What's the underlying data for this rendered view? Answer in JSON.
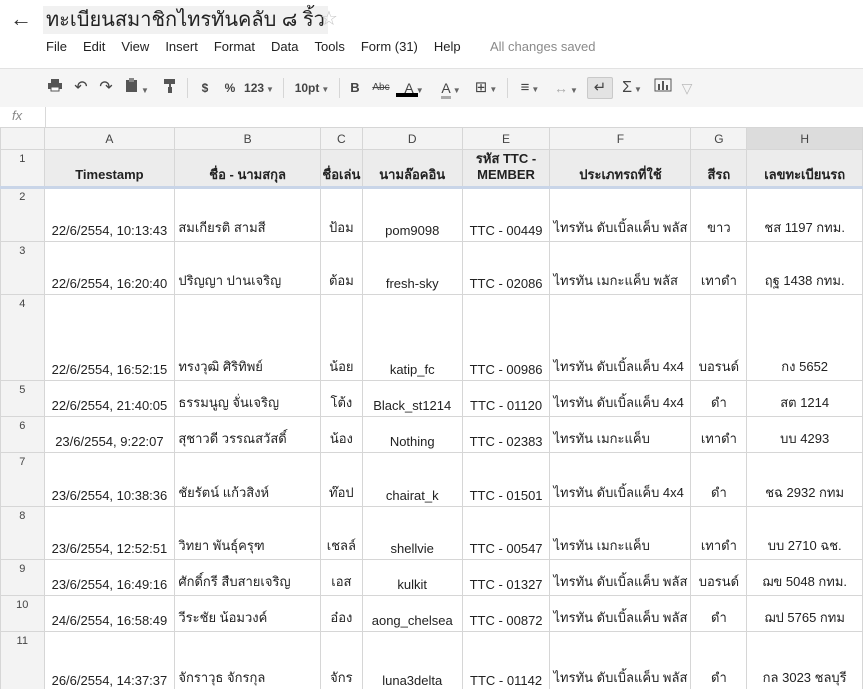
{
  "doc": {
    "title": "ทะเบียนสมาชิกไทรทันคลับ ๘ ริ้ว",
    "saved_status": "All changes saved"
  },
  "icons": {
    "back": "back-arrow-icon",
    "star": "star-icon"
  },
  "menu": [
    "File",
    "Edit",
    "View",
    "Insert",
    "Format",
    "Data",
    "Tools",
    "Form (31)",
    "Help"
  ],
  "toolbar": {
    "currency": "$",
    "percent": "%",
    "number_format": "123",
    "font_size": "10pt",
    "bold": "B",
    "strikethrough": "Abc",
    "text_color": "A",
    "highlight": "A",
    "sum": "Σ",
    "text_color_value": "#000000"
  },
  "formula_bar": {
    "label": "fx",
    "value": ""
  },
  "columns": [
    "A",
    "B",
    "C",
    "D",
    "E",
    "F",
    "G",
    "H"
  ],
  "selected_column": "H",
  "headers": [
    "Timestamp",
    "ชื่อ - นามสกุล",
    "ชื่อเล่น",
    "นามล๊อคอิน",
    "รหัส TTC - MEMBER",
    "ประเภทรถที่ใช้",
    "สีรถ",
    "เลขทะเบียนรถ"
  ],
  "rows": [
    {
      "num": "1"
    },
    {
      "num": "2",
      "cells": [
        "22/6/2554, 10:13:43",
        "สมเกียรติ สามสี",
        "ป้อม",
        "pom9098",
        "TTC - 00449",
        "ไทรทัน ดับเบิ้ลแค็บ พลัส",
        "ขาว",
        "ชส 1197 กทม."
      ]
    },
    {
      "num": "3",
      "cells": [
        "22/6/2554, 16:20:40",
        "ปริญญา ปานเจริญ",
        "ต้อม",
        "fresh-sky",
        "TTC - 02086",
        "ไทรทัน เมกะแค็บ พลัส",
        "เทาดำ",
        "ฤฐ 1438 กทม."
      ]
    },
    {
      "num": "4",
      "cells": [
        "22/6/2554, 16:52:15",
        "ทรงวุฒิ ศิริทิพย์",
        "น้อย",
        "katip_fc",
        "TTC - 00986",
        "ไทรทัน ดับเบิ้ลแค็บ 4x4",
        "บอรนด์",
        "กง 5652"
      ]
    },
    {
      "num": "5",
      "cells": [
        "22/6/2554, 21:40:05",
        "ธรรมนูญ จั่นเจริญ",
        "โต้ง",
        "Black_st1214",
        "TTC - 01120",
        "ไทรทัน ดับเบิ้ลแค็บ 4x4",
        "ดำ",
        "สต 1214"
      ]
    },
    {
      "num": "6",
      "cells": [
        "23/6/2554, 9:22:07",
        "สุชาวดี วรรณสวัสดิ์",
        "น้อง",
        "Nothing",
        "TTC - 02383",
        "ไทรทัน เมกะแค็บ",
        "เทาดำ",
        "บบ 4293"
      ]
    },
    {
      "num": "7",
      "cells": [
        "23/6/2554, 10:38:36",
        "ชัยรัตน์ แก้วสิงห์",
        "ท๊อป",
        "chairat_k",
        "TTC - 01501",
        "ไทรทัน ดับเบิ้ลแค็บ 4x4",
        "ดำ",
        "ชฉ 2932 กทม"
      ]
    },
    {
      "num": "8",
      "cells": [
        "23/6/2554, 12:52:51",
        "วิทยา พันธุ์ครุฑ",
        "เชลล์",
        "shellvie",
        "TTC - 00547",
        "ไทรทัน เมกะแค็บ",
        "เทาดำ",
        "บบ 2710 ฉช."
      ]
    },
    {
      "num": "9",
      "cells": [
        "23/6/2554, 16:49:16",
        "ศักดิ์กรี สืบสายเจริญ",
        "เอส",
        "kulkit",
        "TTC - 01327",
        "ไทรทัน ดับเบิ้ลแค็บ พลัส",
        "บอรนด์",
        "ฌข 5048 กทม."
      ]
    },
    {
      "num": "10",
      "cells": [
        "24/6/2554, 16:58:49",
        "วีระชัย น้อมวงค์",
        "อ๋อง",
        "aong_chelsea",
        "TTC - 00872",
        "ไทรทัน ดับเบิ้ลแค็บ พลัส",
        "ดำ",
        "ฌป 5765 กทม"
      ]
    },
    {
      "num": "11",
      "cells": [
        "26/6/2554, 14:37:37",
        "จักราวุธ จักรกุล",
        "จักร",
        "luna3delta",
        "TTC - 01142",
        "ไทรทัน ดับเบิ้ลแค็บ พลัส",
        "ดำ",
        "กล 3023 ชลบุรี"
      ]
    }
  ]
}
